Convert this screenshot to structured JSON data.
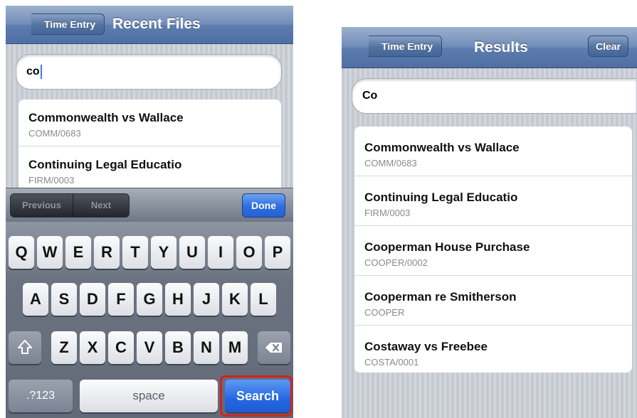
{
  "left_screen": {
    "nav": {
      "back_label": "Time Entry",
      "title": "Recent Files"
    },
    "search": {
      "value": "co"
    },
    "results": [
      {
        "title": "Commonwealth vs Wallace",
        "code": "COMM/0683"
      },
      {
        "title": "Continuing Legal Educatio",
        "code": "FIRM/0003"
      }
    ],
    "accessory": {
      "previous_label": "Previous",
      "next_label": "Next",
      "done_label": "Done"
    },
    "keyboard": {
      "row1": [
        "Q",
        "W",
        "E",
        "R",
        "T",
        "Y",
        "U",
        "I",
        "O",
        "P"
      ],
      "row2": [
        "A",
        "S",
        "D",
        "F",
        "G",
        "H",
        "J",
        "K",
        "L"
      ],
      "row3": [
        "Z",
        "X",
        "C",
        "V",
        "B",
        "N",
        "M"
      ],
      "numbers_label": ".?123",
      "space_label": "space",
      "search_label": "Search",
      "shift_icon": "shift-arrow-icon",
      "delete_icon": "backspace-icon"
    },
    "highlight_color": "#d0231f"
  },
  "right_screen": {
    "nav": {
      "back_label": "Time Entry",
      "title": "Results",
      "clear_label": "Clear"
    },
    "search": {
      "value": "Co"
    },
    "results": [
      {
        "title": "Commonwealth vs Wallace",
        "code": "COMM/0683"
      },
      {
        "title": "Continuing Legal Educatio",
        "code": "FIRM/0003"
      },
      {
        "title": "Cooperman House Purchase",
        "code": "COOPER/0002"
      },
      {
        "title": "Cooperman re Smitherson",
        "code": "COOPER"
      },
      {
        "title": "Costaway vs Freebee",
        "code": "COSTA/0001"
      }
    ]
  },
  "colors": {
    "nav_bar": "#6f8cb8",
    "search_key": "#2566e0",
    "done_button": "#2e6de0"
  }
}
